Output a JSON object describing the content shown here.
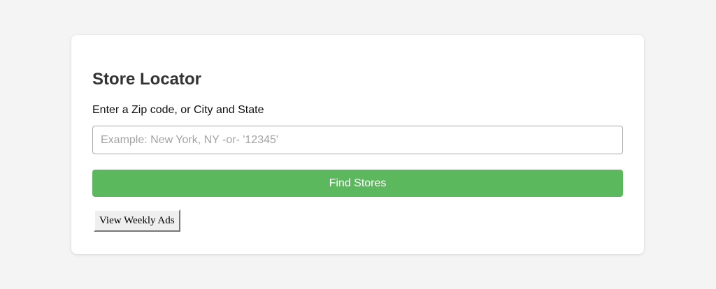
{
  "store_locator": {
    "title": "Store Locator",
    "field_label": "Enter a Zip code, or City and State",
    "search": {
      "value": "",
      "placeholder": "Example: New York, NY -or- '12345'"
    },
    "find_button_label": "Find Stores",
    "weekly_ads_label": "View Weekly Ads"
  },
  "colors": {
    "page_background": "#f4f4f4",
    "card_background": "#ffffff",
    "accent_green": "#5cb85c",
    "title_text": "#333333"
  }
}
